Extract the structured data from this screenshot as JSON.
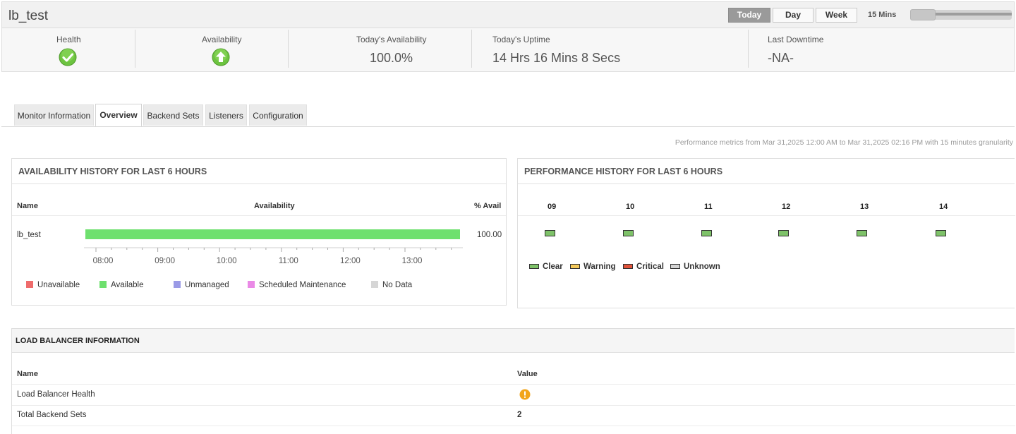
{
  "header": {
    "monitor_name": "lb_test",
    "period_buttons": [
      "Today",
      "Day",
      "Week"
    ],
    "active_period": "Today",
    "refresh_label": "15 Mins"
  },
  "summary": {
    "health_label": "Health",
    "availability_label": "Availability",
    "todays_availability_label": "Today's Availability",
    "todays_availability_value": "100.0%",
    "todays_uptime_label": "Today's Uptime",
    "todays_uptime_value": "14 Hrs 16 Mins 8 Secs",
    "last_downtime_label": "Last Downtime",
    "last_downtime_value": "-NA-"
  },
  "tabs": [
    "Monitor Information",
    "Overview",
    "Backend Sets",
    "Listeners",
    "Configuration"
  ],
  "active_tab": "Overview",
  "perf_note": "Performance metrics from Mar 31,2025 12:00 AM to Mar 31,2025 02:16 PM with 15 minutes granularity",
  "availability_history": {
    "title": "AVAILABILITY HISTORY FOR LAST 6 HOURS",
    "col_name": "Name",
    "col_availability": "Availability",
    "col_avail_pct": "% Avail",
    "row_name": "lb_test",
    "row_value": "100.00",
    "axis_labels": [
      "08:00",
      "09:00",
      "10:00",
      "11:00",
      "12:00",
      "13:00"
    ],
    "available_fraction": 1.0,
    "legend": [
      {
        "label": "Unavailable",
        "color": "#ef6c6c"
      },
      {
        "label": "Available",
        "color": "#6ee06e"
      },
      {
        "label": "Unmanaged",
        "color": "#9a9ae6"
      },
      {
        "label": "Scheduled Maintenance",
        "color": "#ea8ae6"
      },
      {
        "label": "No Data",
        "color": "#d6d6d6"
      }
    ]
  },
  "performance_history": {
    "title": "PERFORMANCE HISTORY FOR LAST 6 HOURS",
    "hours": [
      "09",
      "10",
      "11",
      "12",
      "13",
      "14"
    ],
    "states": [
      "Clear",
      "Clear",
      "Clear",
      "Clear",
      "Clear",
      "Clear"
    ],
    "legend": [
      {
        "label": "Clear",
        "color": "#7ec269"
      },
      {
        "label": "Warning",
        "color": "#f4c95a"
      },
      {
        "label": "Critical",
        "color": "#e0523a"
      },
      {
        "label": "Unknown",
        "color": "#d4d4d4"
      }
    ]
  },
  "lb_info": {
    "title": "LOAD BALANCER INFORMATION",
    "col_name": "Name",
    "col_value": "Value",
    "rows": [
      {
        "name": "Load Balancer Health",
        "value": ""
      },
      {
        "name": "Total Backend Sets",
        "value": "2"
      }
    ]
  },
  "colors": {
    "ok_green": "#6cc33f",
    "warning_orange": "#f2a51a",
    "active_tab_grey": "#9a9a9a"
  }
}
